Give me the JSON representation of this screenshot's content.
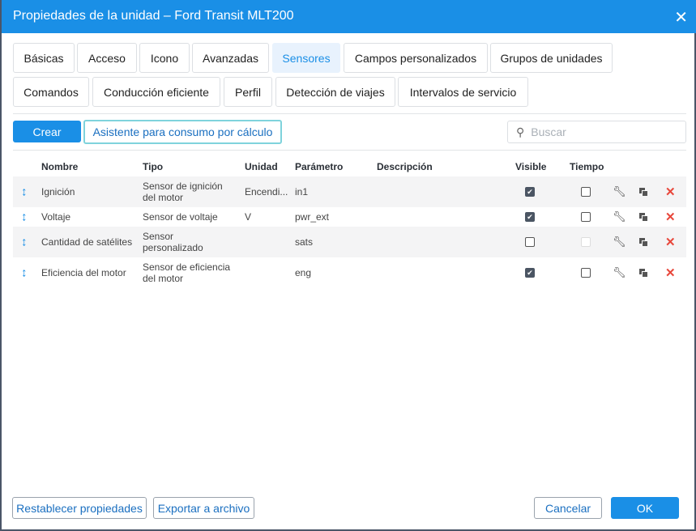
{
  "title": "Propiedades de la unidad – Ford Transit MLT200",
  "tabs": [
    "Básicas",
    "Acceso",
    "Icono",
    "Avanzadas",
    "Sensores",
    "Campos personalizados",
    "Grupos de unidades",
    "Comandos",
    "Conducción eficiente",
    "Perfil",
    "Detección de viajes",
    "Intervalos de servicio"
  ],
  "toolbar": {
    "create": "Crear",
    "wizard": "Asistente para consumo por cálculo",
    "search_placeholder": "Buscar"
  },
  "columns": [
    "Nombre",
    "Tipo",
    "Unidad",
    "Parámetro",
    "Descripción",
    "Visible",
    "Tiempo"
  ],
  "rows": [
    {
      "name": "Ignición",
      "type1": "Sensor de ignición",
      "type2": "del motor",
      "unit": "Encendi...",
      "param": "in1",
      "desc": "",
      "visible": true,
      "time": false,
      "time_disabled": false
    },
    {
      "name": "Voltaje",
      "type1": "Sensor de voltaje",
      "type2": "",
      "unit": "V",
      "param": "pwr_ext",
      "desc": "",
      "visible": true,
      "time": false,
      "time_disabled": false
    },
    {
      "name": "Cantidad de satélites",
      "type1": "Sensor",
      "type2": "personalizado",
      "unit": "",
      "param": "sats",
      "desc": "",
      "visible": false,
      "time": false,
      "time_disabled": true
    },
    {
      "name": "Eficiencia del motor",
      "type1": "Sensor de eficiencia",
      "type2": "del motor",
      "unit": "",
      "param": "eng",
      "desc": "",
      "visible": true,
      "time": false,
      "time_disabled": false
    }
  ],
  "footer": {
    "reset": "Restablecer propiedades",
    "export": "Exportar a archivo",
    "cancel": "Cancelar",
    "ok": "OK"
  }
}
